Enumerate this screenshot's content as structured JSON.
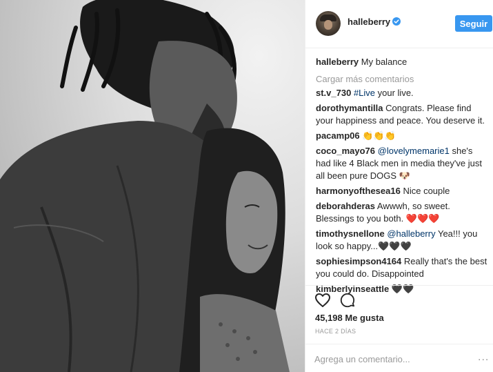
{
  "post": {
    "username": "halleberry",
    "follow_label": "Seguir",
    "caption_text": "My balance"
  },
  "load_more_label": "Cargar más comentarios",
  "comments": [
    {
      "user": "st.v_730",
      "tag": "#Live",
      "text": " your live."
    },
    {
      "user": "dorothymantilla",
      "tag": "",
      "text": "Congrats. Please find your happiness and peace. You deserve it."
    },
    {
      "user": "pacamp06",
      "tag": "",
      "text": "👏👏👏"
    },
    {
      "user": "coco_mayo76",
      "tag": "@lovelymemarie1",
      "text": " she's had like 4 Black men in media they've just all been pure DOGS 🐶"
    },
    {
      "user": "harmonyofthesea16",
      "tag": "",
      "text": "Nice couple"
    },
    {
      "user": "deborahderas",
      "tag": "",
      "text": "Awwwh, so sweet. Blessings to you both. ❤️❤️❤️"
    },
    {
      "user": "timothysnellone",
      "tag": "@halleberry",
      "text": " Yea!!! you look so happy...🖤🖤🖤"
    },
    {
      "user": "sophiesimpson4164",
      "tag": "",
      "text": "Really that's the best you could do. Disappointed"
    },
    {
      "user": "kimberlyinseattle",
      "tag": "",
      "text": "🖤🖤"
    }
  ],
  "likes_text": "45,198 Me gusta",
  "timestamp_text": "HACE 2 DÍAS",
  "comment_placeholder": "Agrega un comentario...",
  "more_options": "...",
  "colors": {
    "accent": "#3897f0",
    "link": "#003569",
    "muted": "#999999"
  }
}
